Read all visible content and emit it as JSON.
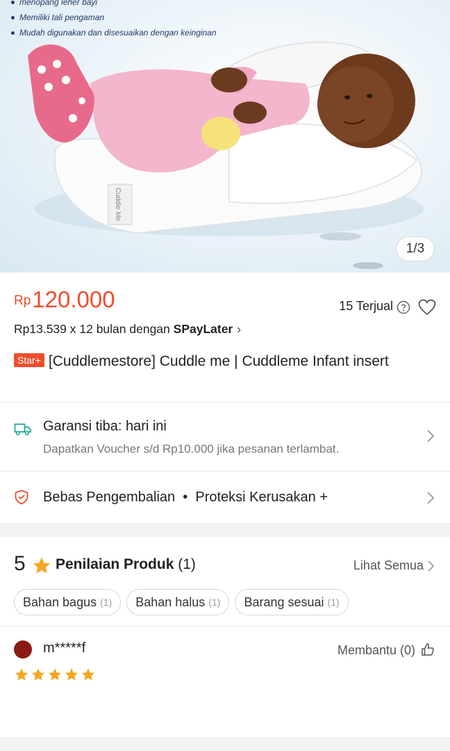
{
  "hero": {
    "bullets": [
      "menopang leher bayi",
      "Memiliki tali pengaman",
      "Mudah digunakan dan disesuaikan dengan keinginan"
    ],
    "pillow_label": "Cuddle Me",
    "image_counter": "1/3"
  },
  "product": {
    "price_currency": "Rp",
    "price": "120.000",
    "sold": "15 Terjual",
    "installment_prefix": "Rp13.539 x 12 bulan dengan ",
    "installment_brand": "SPayLater",
    "badge": "Star+",
    "title": "[Cuddlemestore] Cuddle me | Cuddleme Infant insert"
  },
  "shipping": {
    "title": "Garansi tiba: hari ini",
    "subtitle": "Dapatkan Voucher s/d Rp10.000 jika pesanan terlambat."
  },
  "protection": {
    "text": "Bebas Pengembalian  •  Proteksi Kerusakan +"
  },
  "reviews": {
    "rating": "5",
    "label": "Penilaian Produk",
    "count": "(1)",
    "see_all": "Lihat Semua",
    "tags": [
      {
        "label": "Bahan bagus",
        "count": "(1)"
      },
      {
        "label": "Bahan halus",
        "count": "(1)"
      },
      {
        "label": "Barang sesuai",
        "count": "(1)"
      }
    ],
    "first_review": {
      "user": "m*****f",
      "helpful": "Membantu (0)",
      "stars": 5
    }
  },
  "colors": {
    "accent": "#ee4d2d",
    "star": "#f5a623",
    "shipping_icon": "#26aa99"
  },
  "icons": [
    "help-icon",
    "heart-icon",
    "chevron-right-icon",
    "truck-icon",
    "shield-icon",
    "star-icon",
    "thumbs-up-icon"
  ]
}
